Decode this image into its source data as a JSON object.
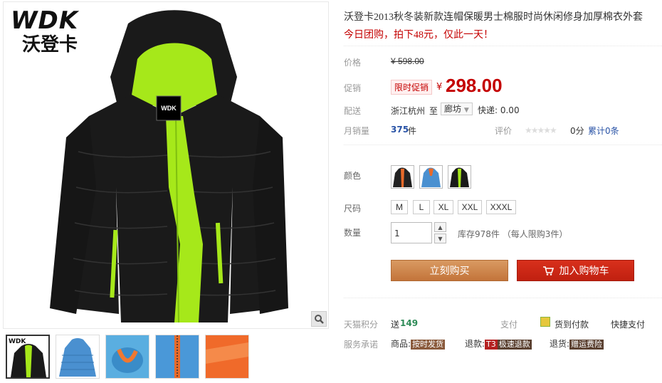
{
  "brand": {
    "logo_en": "WDK",
    "logo_cn": "沃登卡"
  },
  "product": {
    "title": "沃登卡2013秋冬装新款连帽保暖男士棉服时尚休闲修身加厚棉衣外套",
    "promo": "今日团购，拍下48元，仅此一天！",
    "price_label": "价格",
    "original_price": "¥ 598.00",
    "sale_label": "促销",
    "sale_tag": "限时促销",
    "currency": "¥",
    "sale_price": "298.00",
    "shipping_label": "配送",
    "ship_from": "浙江杭州",
    "ship_to_label": "至",
    "ship_dest": "廊坊",
    "express": "快递: 0.00",
    "sales_label": "月销量",
    "sales_count": "375",
    "sales_unit": "件",
    "rating_label": "评价",
    "rating_score": "0分",
    "rating_total": "累计0条"
  },
  "sku": {
    "color_label": "颜色",
    "size_label": "尺码",
    "sizes": [
      "M",
      "L",
      "XL",
      "XXL",
      "XXXL"
    ],
    "qty_label": "数量",
    "qty_value": "1",
    "stock_text": "库存978件 （每人限购3件）"
  },
  "actions": {
    "buy_now": "立刻购买",
    "add_cart": "加入购物车"
  },
  "services": {
    "points_label": "天猫积分",
    "points_prefix": "送",
    "points_value": "149",
    "pay_label": "支付",
    "cod": "货到付款",
    "quick_pay": "快捷支付",
    "promise_label": "服务承诺",
    "goods_label": "商品:",
    "goods_tag": "按时发货",
    "refund_label": "退款:",
    "refund_num": "T3",
    "refund_tag": "极速退款",
    "return_label": "退货:",
    "return_tag": "赠运费险"
  },
  "colors": {
    "jacket_black": "#1a1a1a",
    "jacket_lime": "#a6e81a",
    "price_red": "#c40000",
    "buy_orange": "#cc7b3d",
    "cart_red": "#c8241a"
  }
}
